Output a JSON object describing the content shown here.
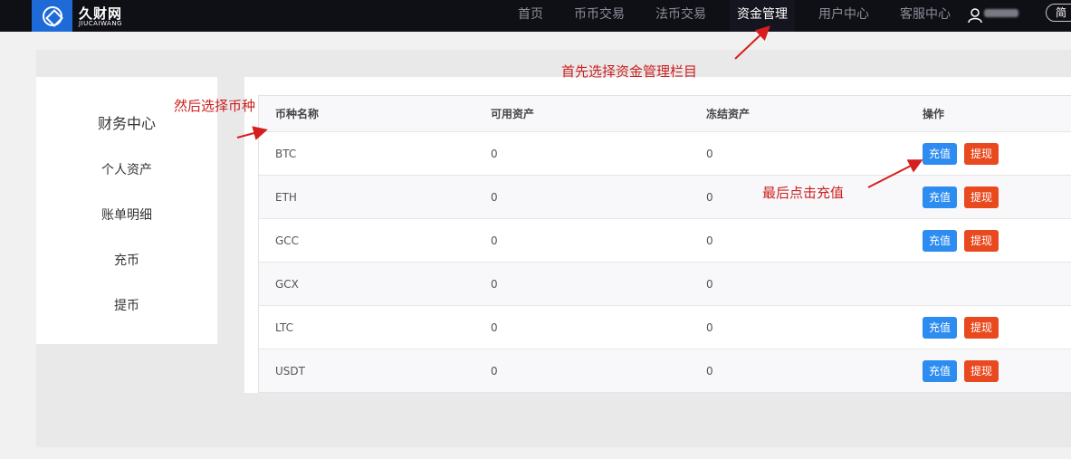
{
  "header": {
    "brand_cn": "久财网",
    "brand_en": "JIUCAIWANG",
    "nav": [
      "首页",
      "币币交易",
      "法币交易",
      "资金管理",
      "用户中心",
      "客服中心"
    ],
    "lang_label": "简"
  },
  "sidebar": {
    "title": "财务中心",
    "items": [
      "个人资产",
      "账单明细",
      "充币",
      "提币"
    ]
  },
  "table": {
    "headers": [
      "币种名称",
      "可用资产",
      "冻结资产",
      "操作"
    ],
    "rows": [
      {
        "coin": "BTC",
        "available": "0",
        "frozen": "0"
      },
      {
        "coin": "ETH",
        "available": "0",
        "frozen": "0"
      },
      {
        "coin": "GCC",
        "available": "0",
        "frozen": "0"
      },
      {
        "coin": "GCX",
        "available": "0",
        "frozen": "0"
      },
      {
        "coin": "LTC",
        "available": "0",
        "frozen": "0"
      },
      {
        "coin": "USDT",
        "available": "0",
        "frozen": "0"
      }
    ],
    "deposit_label": "充值",
    "withdraw_label": "提现"
  },
  "annotations": {
    "step1": "首先选择资金管理栏目",
    "step2": "然后选择币种",
    "step3": "最后点击充值"
  },
  "colors": {
    "accent": "#2d8cf0",
    "danger": "#e9491e",
    "annotation": "#cc1f1f"
  }
}
